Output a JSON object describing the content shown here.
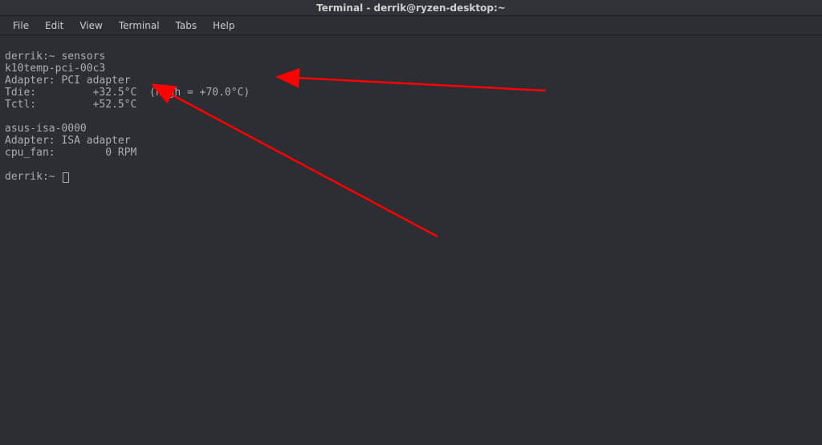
{
  "window": {
    "title": "Terminal - derrik@ryzen-desktop:~"
  },
  "menu": {
    "file": "File",
    "edit": "Edit",
    "view": "View",
    "terminal": "Terminal",
    "tabs": "Tabs",
    "help": "Help"
  },
  "terminal": {
    "line1": "derrik:~ sensors",
    "line2": "k10temp-pci-00c3",
    "line3": "Adapter: PCI adapter",
    "line4": "Tdie:         +32.5°C  (high = +70.0°C)",
    "line5": "Tctl:         +52.5°C",
    "line6": "",
    "line7": "asus-isa-0000",
    "line8": "Adapter: ISA adapter",
    "line9": "cpu_fan:        0 RPM",
    "line10": "",
    "prompt_line": "derrik:~ "
  },
  "annotations": {
    "arrow_color": "#ff0000"
  }
}
